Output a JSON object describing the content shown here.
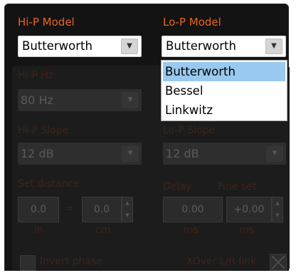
{
  "hip_model": {
    "label": "Hi-P Model",
    "value": "Butterworth"
  },
  "lop_model": {
    "label": "Lo-P Model",
    "value": "Butterworth",
    "options": [
      "Butterworth",
      "Bessel",
      "Linkwitz"
    ],
    "highlighted": "Butterworth"
  },
  "hip_hz": {
    "label": "Hi-P Hz",
    "value": "80 Hz"
  },
  "hip_slope": {
    "label": "Hi-P Slope",
    "value": "12 dB"
  },
  "lop_slope": {
    "label": "Lo-P Slope",
    "value": "12 dB"
  },
  "distance": {
    "label": "Set distance",
    "inches": "0.0",
    "cm": "0.0",
    "unit_in": "in",
    "unit_cm": "cm",
    "separator": "="
  },
  "delay": {
    "label": "Delay",
    "value": "0.00",
    "unit": "ms"
  },
  "fine_set": {
    "label": "Fine set",
    "value": "+0.00",
    "unit": "ms"
  },
  "invert_phase": {
    "label": "Invert phase",
    "checked": false
  },
  "xover_link": {
    "label": "XOver L/R link",
    "checked": false
  },
  "colors": {
    "accent": "#e8641f",
    "background": "#131313",
    "highlight": "#99c9ef"
  }
}
